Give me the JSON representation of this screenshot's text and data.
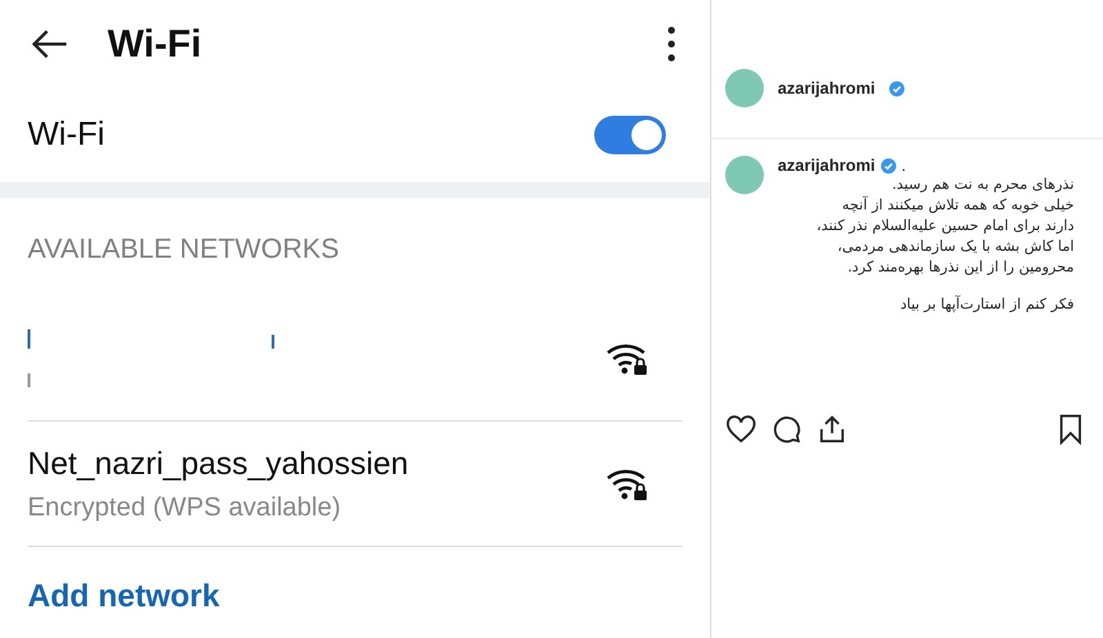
{
  "wifi_screen": {
    "title": "Wi-Fi",
    "toggle": {
      "label": "Wi-Fi",
      "on": true
    },
    "section_title": "AVAILABLE NETWORKS",
    "networks": [
      {
        "kind": "redacted",
        "secured": true
      },
      {
        "kind": "named",
        "name": "Net_nazri_pass_yahossien",
        "status": "Encrypted (WPS available)",
        "secured": true
      }
    ],
    "add_network": "Add network"
  },
  "post": {
    "username": "azarijahromi",
    "verified": true,
    "caption": {
      "username": "azarijahromi",
      "verified": true,
      "suffix": ".",
      "lines": [
        "نذرهای محرم به نت هم رسید.",
        "خیلی خوبه که همه تلاش میکنند از آنچه",
        "دارند برای امام حسین علیه‌السلام نذر کنند،",
        "اما کاش بشه با یک سازماندهی مردمی،",
        "محرومین را از این نذرها بهره‌مند کرد."
      ],
      "closing": "فکر کنم از استارت‌آپها بر بیاد"
    }
  }
}
